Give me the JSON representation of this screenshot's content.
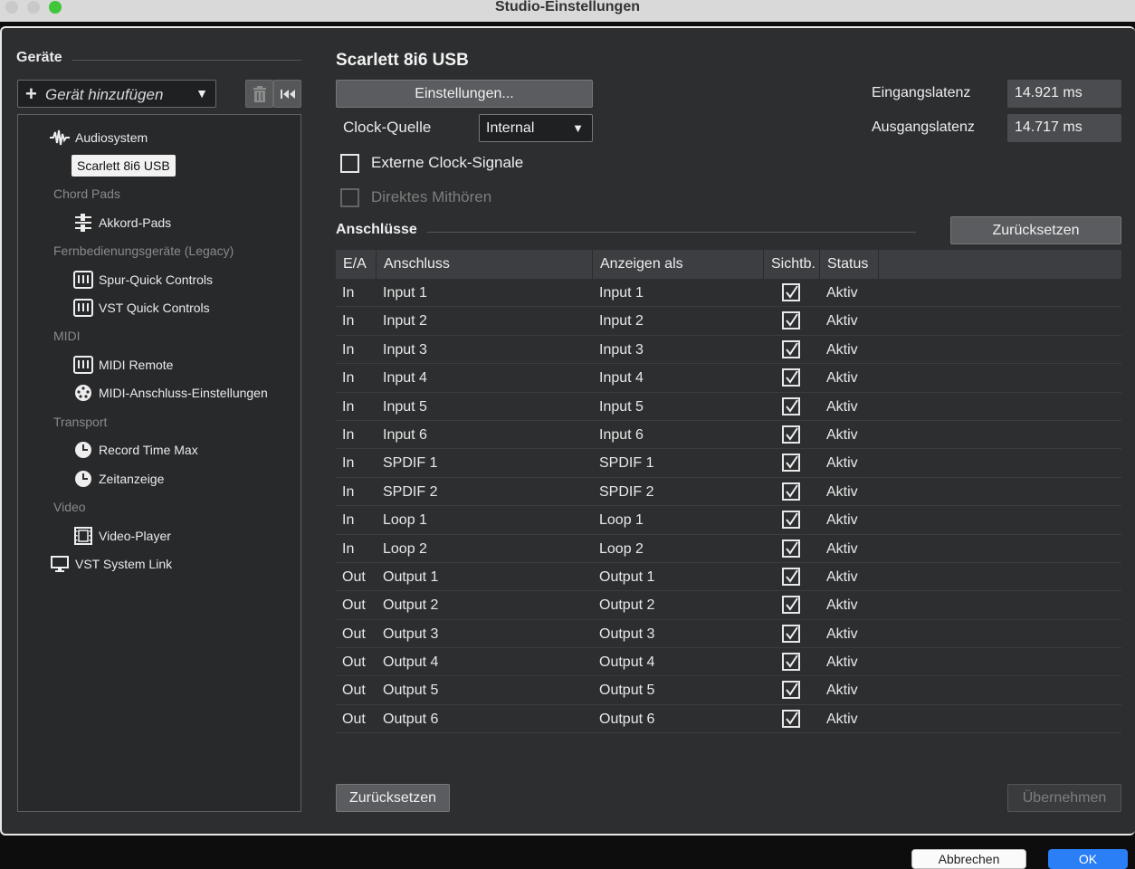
{
  "window": {
    "title": "Studio-Einstellungen"
  },
  "sidebar": {
    "heading": "Geräte",
    "add_device_label": "Gerät hinzufügen",
    "tree": [
      {
        "kind": "item",
        "label": "Audiosystem",
        "icon": "waveform-icon",
        "level": 0
      },
      {
        "kind": "item",
        "label": "Scarlett 8i6 USB",
        "icon": "",
        "level": 1,
        "selected": true
      },
      {
        "kind": "category",
        "label": "Chord Pads"
      },
      {
        "kind": "item",
        "label": "Akkord-Pads",
        "icon": "sliders-icon",
        "level": 1
      },
      {
        "kind": "category",
        "label": "Fernbedienungsgeräte (Legacy)"
      },
      {
        "kind": "item",
        "label": "Spur-Quick Controls",
        "icon": "keyboard-icon",
        "level": 1
      },
      {
        "kind": "item",
        "label": "VST Quick Controls",
        "icon": "keyboard-icon",
        "level": 1
      },
      {
        "kind": "category",
        "label": "MIDI"
      },
      {
        "kind": "item",
        "label": "MIDI Remote",
        "icon": "keyboard-icon",
        "level": 1
      },
      {
        "kind": "item",
        "label": "MIDI-Anschluss-Einstellungen",
        "icon": "midi-port-icon",
        "level": 1
      },
      {
        "kind": "category",
        "label": "Transport"
      },
      {
        "kind": "item",
        "label": "Record Time Max",
        "icon": "clock-icon",
        "level": 1
      },
      {
        "kind": "item",
        "label": "Zeitanzeige",
        "icon": "clock-icon",
        "level": 1
      },
      {
        "kind": "category",
        "label": "Video"
      },
      {
        "kind": "item",
        "label": "Video-Player",
        "icon": "film-icon",
        "level": 1
      },
      {
        "kind": "item",
        "label": "VST System Link",
        "icon": "monitor-icon",
        "level": 0
      }
    ]
  },
  "device": {
    "title": "Scarlett 8i6 USB",
    "settings_button": "Einstellungen...",
    "clock_source_label": "Clock-Quelle",
    "clock_source_value": "Internal",
    "external_clock_label": "Externe Clock-Signale",
    "direct_monitoring_label": "Direktes Mithören",
    "input_latency_label": "Eingangslatenz",
    "input_latency_value": "14.921 ms",
    "output_latency_label": "Ausgangslatenz",
    "output_latency_value": "14.717 ms"
  },
  "connections": {
    "heading": "Anschlüsse",
    "reset_label": "Zurücksetzen",
    "columns": [
      "E/A",
      "Anschluss",
      "Anzeigen als",
      "Sichtb.",
      "Status"
    ],
    "rows": [
      {
        "io": "In",
        "port": "Input 1",
        "display": "Input 1",
        "visible": true,
        "status": "Aktiv"
      },
      {
        "io": "In",
        "port": "Input 2",
        "display": "Input 2",
        "visible": true,
        "status": "Aktiv"
      },
      {
        "io": "In",
        "port": "Input 3",
        "display": "Input 3",
        "visible": true,
        "status": "Aktiv"
      },
      {
        "io": "In",
        "port": "Input 4",
        "display": "Input 4",
        "visible": true,
        "status": "Aktiv"
      },
      {
        "io": "In",
        "port": "Input 5",
        "display": "Input 5",
        "visible": true,
        "status": "Aktiv"
      },
      {
        "io": "In",
        "port": "Input 6",
        "display": "Input 6",
        "visible": true,
        "status": "Aktiv"
      },
      {
        "io": "In",
        "port": "SPDIF 1",
        "display": "SPDIF 1",
        "visible": true,
        "status": "Aktiv"
      },
      {
        "io": "In",
        "port": "SPDIF 2",
        "display": "SPDIF 2",
        "visible": true,
        "status": "Aktiv"
      },
      {
        "io": "In",
        "port": "Loop 1",
        "display": "Loop 1",
        "visible": true,
        "status": "Aktiv"
      },
      {
        "io": "In",
        "port": "Loop 2",
        "display": "Loop 2",
        "visible": true,
        "status": "Aktiv"
      },
      {
        "io": "Out",
        "port": "Output 1",
        "display": "Output 1",
        "visible": true,
        "status": "Aktiv"
      },
      {
        "io": "Out",
        "port": "Output 2",
        "display": "Output 2",
        "visible": true,
        "status": "Aktiv"
      },
      {
        "io": "Out",
        "port": "Output 3",
        "display": "Output 3",
        "visible": true,
        "status": "Aktiv"
      },
      {
        "io": "Out",
        "port": "Output 4",
        "display": "Output 4",
        "visible": true,
        "status": "Aktiv"
      },
      {
        "io": "Out",
        "port": "Output 5",
        "display": "Output 5",
        "visible": true,
        "status": "Aktiv"
      },
      {
        "io": "Out",
        "port": "Output 6",
        "display": "Output 6",
        "visible": true,
        "status": "Aktiv"
      }
    ]
  },
  "footer": {
    "reset_label": "Zurücksetzen",
    "apply_label": "Übernehmen",
    "cancel_label": "Abbrechen",
    "ok_label": "OK"
  }
}
